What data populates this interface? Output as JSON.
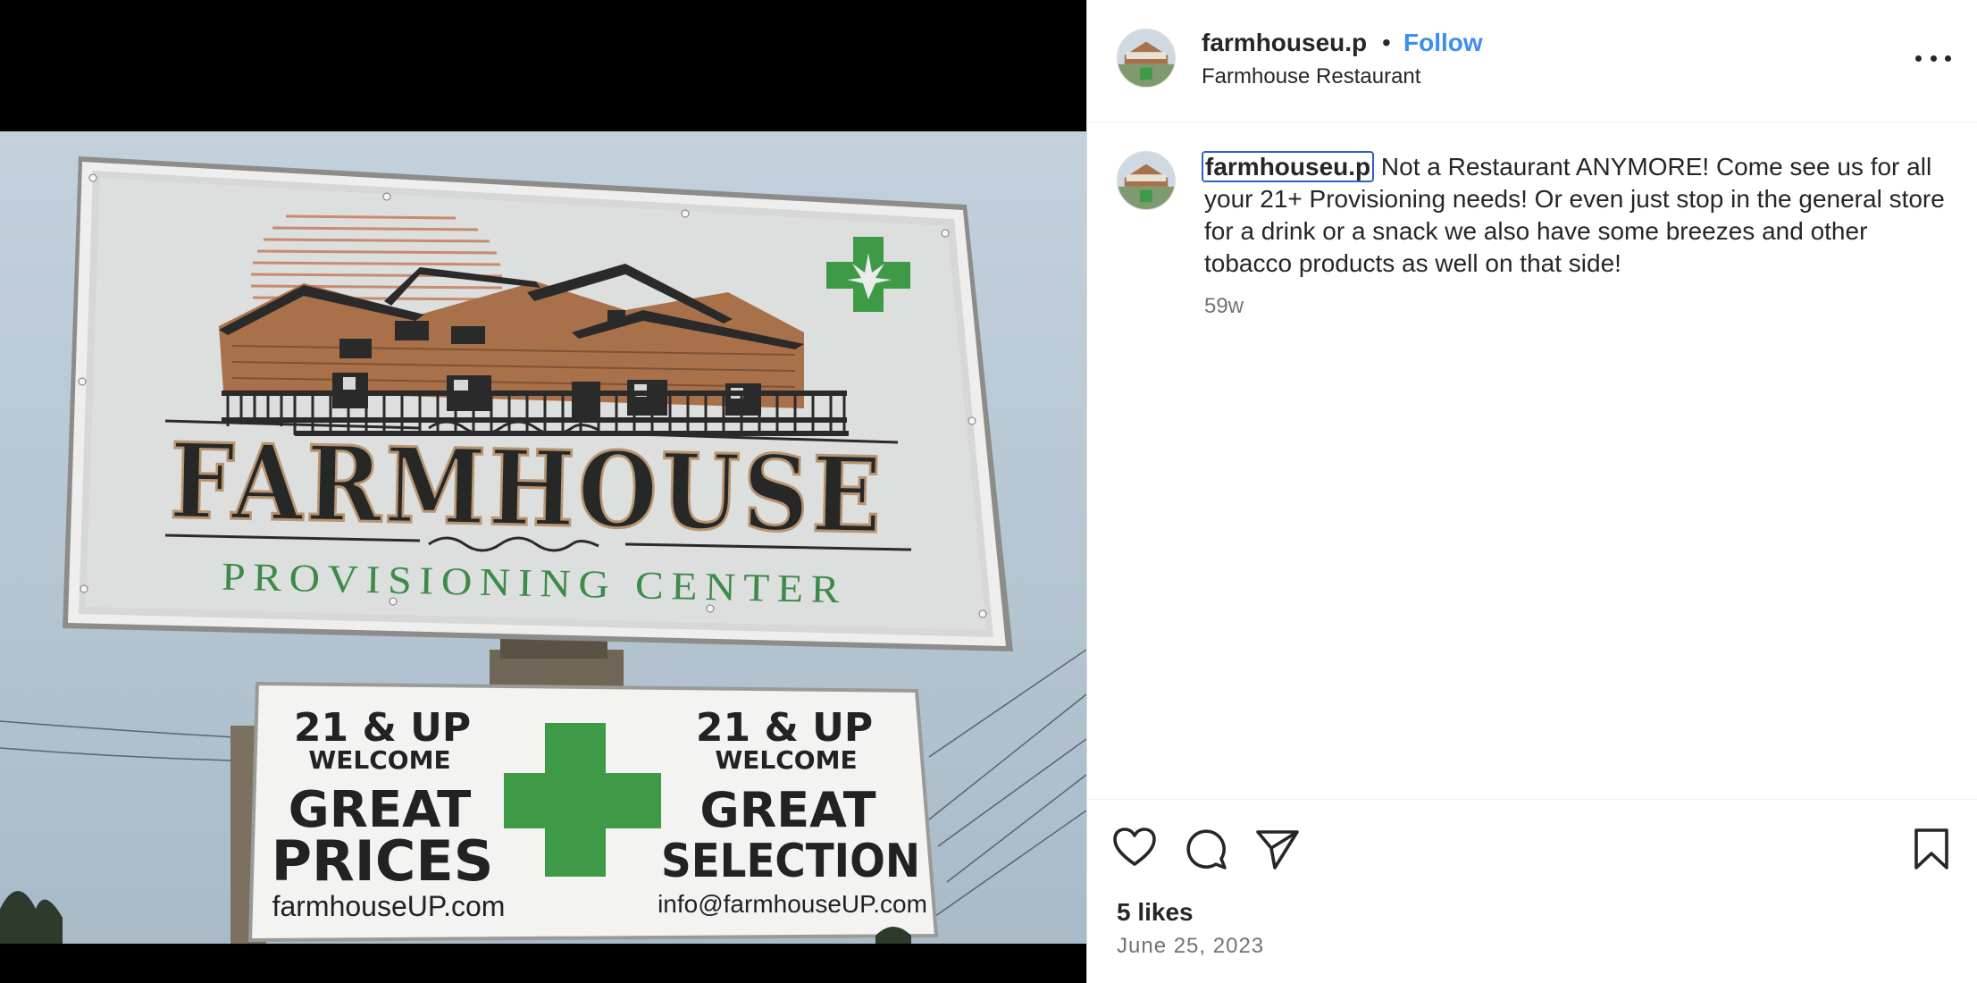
{
  "post": {
    "username": "farmhouseu.p",
    "separator": "•",
    "follow_label": "Follow",
    "location": "Farmhouse Restaurant",
    "more_icon": "more-options-icon"
  },
  "caption": {
    "username": "farmhouseu.p",
    "text": "Not a Restaurant ANYMORE! Come see us for all your 21+ Provisioning needs! Or even just stop in the general store for a drink or a snack we also have some breezes and other tobacco products as well on that side!",
    "time_ago": "59w"
  },
  "actions": {
    "like_icon": "heart-icon",
    "comment_icon": "comment-icon",
    "share_icon": "share-icon",
    "save_icon": "bookmark-icon",
    "likes_text": "5 likes",
    "date": "June 25, 2023"
  },
  "photo": {
    "sign_title": "FARMHOUSE",
    "sign_subtitle": "PROVISIONING CENTER",
    "left_panel": {
      "line1": "21 & UP",
      "line2": "WELCOME",
      "line3": "GREAT",
      "line4": "PRICES",
      "url": "farmhouseUP.com"
    },
    "right_panel": {
      "line1": "21 & UP",
      "line2": "WELCOME",
      "line3": "GREAT",
      "line4": "SELECTION",
      "url": "info@farmhouseUP.com"
    },
    "colors": {
      "cross_green": "#3e9a47",
      "sign_bg": "#d9dcdc",
      "sky": "#b8c8d6",
      "house_brown": "#a8714a"
    }
  }
}
